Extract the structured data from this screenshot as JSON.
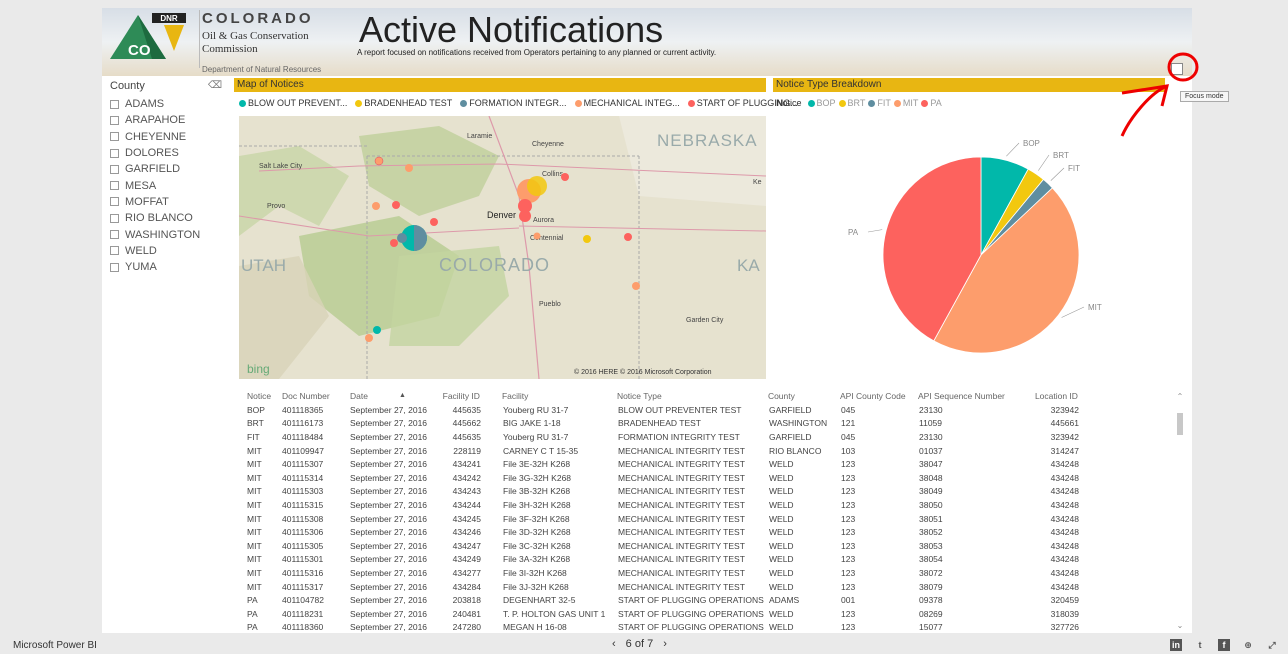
{
  "header": {
    "logo_badge": "DNR",
    "logo_state_abbr": "CO",
    "state_name": "COLORADO",
    "commission_line1": "Oil & Gas Conservation",
    "commission_line2": "Commission",
    "department": "Department of Natural Resources",
    "title": "Active Notifications",
    "subtitle": "A report focused on notifications received from Operators pertaining to any planned or current activity."
  },
  "slicer": {
    "title": "County",
    "items": [
      "ADAMS",
      "ARAPAHOE",
      "CHEYENNE",
      "DOLORES",
      "GARFIELD",
      "MESA",
      "MOFFAT",
      "RIO BLANCO",
      "WASHINGTON",
      "WELD",
      "YUMA"
    ]
  },
  "map_panel": {
    "title": "Map of Notices",
    "legend": [
      {
        "label": "BLOW OUT PREVENT...",
        "color": "#01b8aa"
      },
      {
        "label": "BRADENHEAD TEST",
        "color": "#f2c80f"
      },
      {
        "label": "FORMATION INTEGR...",
        "color": "#5f8ea0"
      },
      {
        "label": "MECHANICAL INTEG...",
        "color": "#fd9d6c"
      },
      {
        "label": "START OF PLUGGING...",
        "color": "#fd625e"
      }
    ],
    "labels": {
      "nebraska": "NEBRASKA",
      "utah": "UTAH",
      "colorado": "COLORADO",
      "ka": "KA",
      "laramie": "Laramie",
      "cheyenne": "Cheyenne",
      "salt_lake": "Salt Lake City",
      "provo": "Provo",
      "denver": "Denver",
      "aurora": "Aurora",
      "centennial": "Centennial",
      "collins": "Collins",
      "ke": "Ke",
      "pueblo": "Pueblo",
      "garden_city": "Garden City",
      "bing": "bing",
      "copyright": "© 2016 HERE   © 2016 Microsoft Corporation"
    }
  },
  "pie_panel": {
    "title": "Notice Type Breakdown",
    "legend_title": "Notice",
    "legend": [
      {
        "label": "BOP",
        "color": "#01b8aa"
      },
      {
        "label": "BRT",
        "color": "#f2c80f"
      },
      {
        "label": "FIT",
        "color": "#5f8ea0"
      },
      {
        "label": "MIT",
        "color": "#fd9d6c"
      },
      {
        "label": "PA",
        "color": "#fd625e"
      }
    ]
  },
  "chart_data": {
    "type": "pie",
    "title": "Notice Type Breakdown",
    "categories": [
      "BOP",
      "BRT",
      "FIT",
      "MIT",
      "PA"
    ],
    "values": [
      8,
      3,
      2,
      45,
      42
    ],
    "colors": [
      "#01b8aa",
      "#f2c80f",
      "#5f8ea0",
      "#fd9d6c",
      "#fd625e"
    ],
    "legend": "top-left"
  },
  "table": {
    "columns": [
      "Notice",
      "Doc Number",
      "Date",
      "Facility ID",
      "Facility",
      "Notice Type",
      "County",
      "API County Code",
      "API Sequence Number",
      "Location ID"
    ],
    "rows": [
      [
        "BOP",
        "401118365",
        "September 27, 2016",
        "445635",
        "Youberg RU 31-7",
        "BLOW OUT PREVENTER TEST",
        "GARFIELD",
        "045",
        "23130",
        "323942"
      ],
      [
        "BRT",
        "401116173",
        "September 27, 2016",
        "445662",
        "BIG JAKE 1-18",
        "BRADENHEAD TEST",
        "WASHINGTON",
        "121",
        "11059",
        "445661"
      ],
      [
        "FIT",
        "401118484",
        "September 27, 2016",
        "445635",
        "Youberg RU 31-7",
        "FORMATION INTEGRITY TEST",
        "GARFIELD",
        "045",
        "23130",
        "323942"
      ],
      [
        "MIT",
        "401109947",
        "September 27, 2016",
        "228119",
        "CARNEY C T 15-35",
        "MECHANICAL INTEGRITY TEST",
        "RIO BLANCO",
        "103",
        "01037",
        "314247"
      ],
      [
        "MIT",
        "401115307",
        "September 27, 2016",
        "434241",
        "File 3E-32H K268",
        "MECHANICAL INTEGRITY TEST",
        "WELD",
        "123",
        "38047",
        "434248"
      ],
      [
        "MIT",
        "401115314",
        "September 27, 2016",
        "434242",
        "File 3G-32H K268",
        "MECHANICAL INTEGRITY TEST",
        "WELD",
        "123",
        "38048",
        "434248"
      ],
      [
        "MIT",
        "401115303",
        "September 27, 2016",
        "434243",
        "File 3B-32H K268",
        "MECHANICAL INTEGRITY TEST",
        "WELD",
        "123",
        "38049",
        "434248"
      ],
      [
        "MIT",
        "401115315",
        "September 27, 2016",
        "434244",
        "File 3H-32H K268",
        "MECHANICAL INTEGRITY TEST",
        "WELD",
        "123",
        "38050",
        "434248"
      ],
      [
        "MIT",
        "401115308",
        "September 27, 2016",
        "434245",
        "File 3F-32H K268",
        "MECHANICAL INTEGRITY TEST",
        "WELD",
        "123",
        "38051",
        "434248"
      ],
      [
        "MIT",
        "401115306",
        "September 27, 2016",
        "434246",
        "File 3D-32H K268",
        "MECHANICAL INTEGRITY TEST",
        "WELD",
        "123",
        "38052",
        "434248"
      ],
      [
        "MIT",
        "401115305",
        "September 27, 2016",
        "434247",
        "File 3C-32H K268",
        "MECHANICAL INTEGRITY TEST",
        "WELD",
        "123",
        "38053",
        "434248"
      ],
      [
        "MIT",
        "401115301",
        "September 27, 2016",
        "434249",
        "File 3A-32H K268",
        "MECHANICAL INTEGRITY TEST",
        "WELD",
        "123",
        "38054",
        "434248"
      ],
      [
        "MIT",
        "401115316",
        "September 27, 2016",
        "434277",
        "File 3I-32H K268",
        "MECHANICAL INTEGRITY TEST",
        "WELD",
        "123",
        "38072",
        "434248"
      ],
      [
        "MIT",
        "401115317",
        "September 27, 2016",
        "434284",
        "File 3J-32H K268",
        "MECHANICAL INTEGRITY TEST",
        "WELD",
        "123",
        "38079",
        "434248"
      ],
      [
        "PA",
        "401104782",
        "September 27, 2016",
        "203818",
        "DEGENHART 32-5",
        "START OF PLUGGING OPERATIONS",
        "ADAMS",
        "001",
        "09378",
        "320459"
      ],
      [
        "PA",
        "401118231",
        "September 27, 2016",
        "240481",
        "T. P. HOLTON GAS UNIT 1",
        "START OF PLUGGING OPERATIONS",
        "WELD",
        "123",
        "08269",
        "318039"
      ],
      [
        "PA",
        "401118360",
        "September 27, 2016",
        "247280",
        "MEGAN H 16-08",
        "START OF PLUGGING OPERATIONS",
        "WELD",
        "123",
        "15077",
        "327726"
      ]
    ]
  },
  "focus": {
    "tooltip": "Focus mode"
  },
  "bottombar": {
    "brand": "Microsoft Power BI",
    "prev": "‹",
    "page": "6 of 7",
    "next": "›",
    "social": [
      "in",
      "t",
      "f",
      "⊕",
      "⤢"
    ]
  }
}
